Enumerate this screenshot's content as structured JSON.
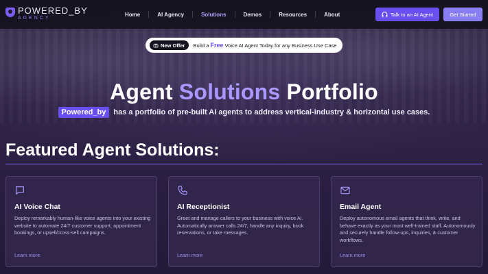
{
  "nav": {
    "logo_line1": "POWERED_BY",
    "logo_line2": "AGENCY",
    "items": [
      {
        "label": "Home"
      },
      {
        "label": "AI Agency"
      },
      {
        "label": "Solutions"
      },
      {
        "label": "Demos"
      },
      {
        "label": "Resources"
      },
      {
        "label": "About"
      }
    ],
    "active_item": "Solutions",
    "talk_button": "Talk to an AI Agent",
    "start_button": "Get Started"
  },
  "offer": {
    "badge": "New Offer",
    "text_before": "Build a",
    "free": "Free",
    "text_after": "Voice AI Agent Today for any Business Use Case"
  },
  "hero": {
    "title_part1": "Agent",
    "title_accent": "Solutions",
    "title_part2": "Portfolio",
    "brand": "Powered_by",
    "subtitle": "has a portfolio of pre-built AI agents to address vertical-industry & horizontal use cases."
  },
  "section": {
    "title": "Featured Agent Solutions:"
  },
  "cards": [
    {
      "icon": "chat-bubble-icon",
      "title": "AI Voice Chat",
      "description": "Deploy remarkably human-like voice agents into your existing website to automate 24/7 customer support, appointment bookings, or upsell/cross-sell campaigns.",
      "link": "Learn more"
    },
    {
      "icon": "phone-icon",
      "title": "AI Receptionist",
      "description": "Greet and manage callers to your business with voice AI. Automatically answer calls 24/7, handle any inquiry, book reservations, or take messages.",
      "link": "Learn more"
    },
    {
      "icon": "mail-icon",
      "title": "Email Agent",
      "description": "Deploy autonomous email agents that think, write, and behave exactly as your most well-trained staff. Autonomously and securely handle follow-ups, inquiries, & customer workflows.",
      "link": "Learn more"
    }
  ],
  "colors": {
    "accent": "#6a4ff0",
    "accent_light": "#a898ff",
    "background": "#2a1f42"
  }
}
